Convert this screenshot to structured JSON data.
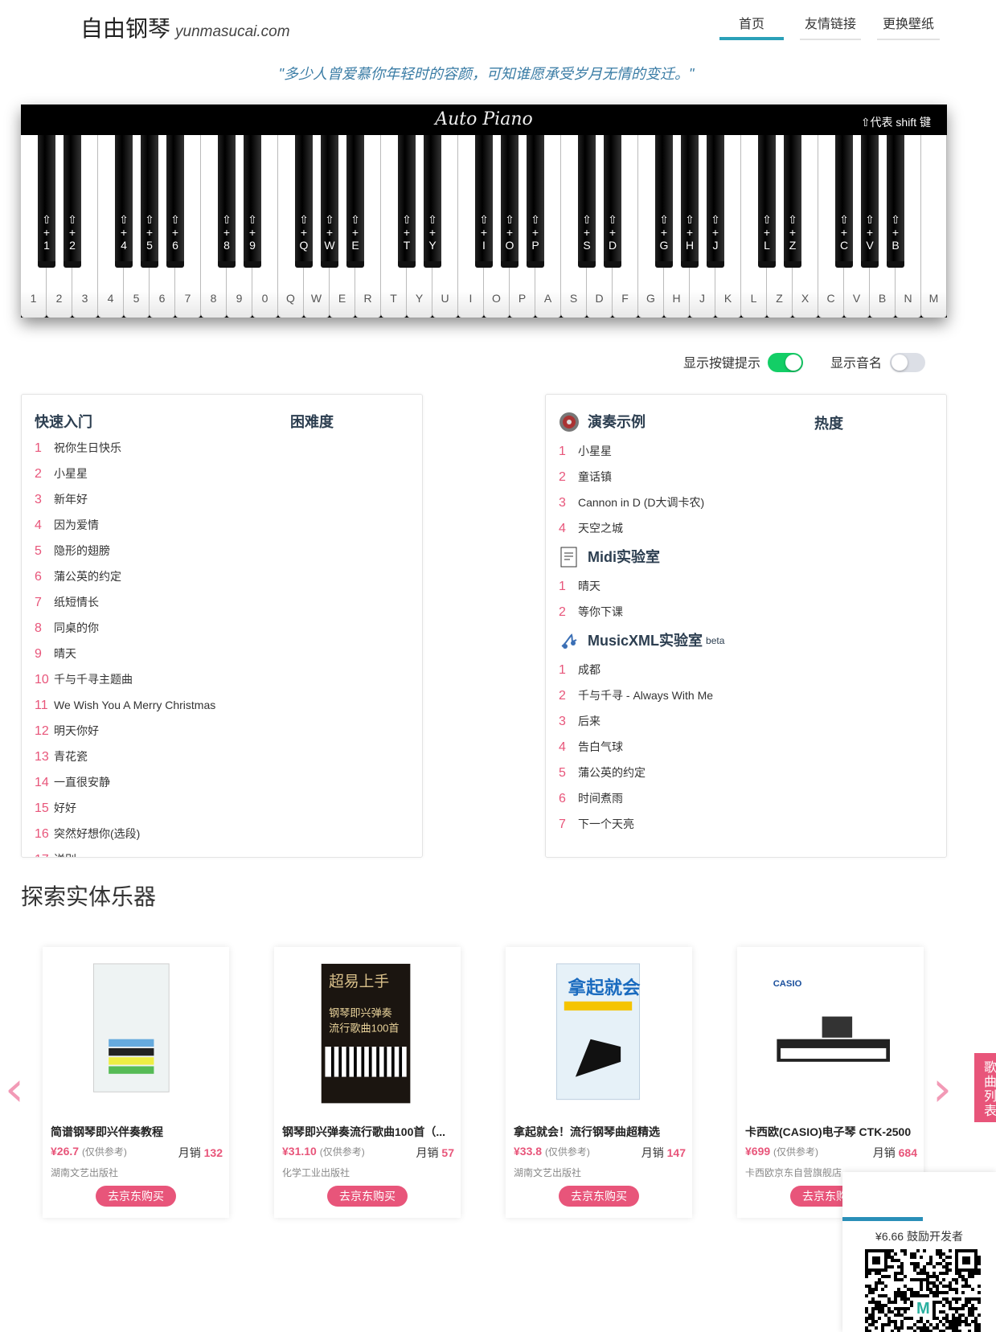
{
  "header": {
    "logo": "自由钢琴",
    "domain": "yunmasucai.com",
    "nav": [
      {
        "label": "首页",
        "active": true
      },
      {
        "label": "友情链接"
      },
      {
        "label": "更换壁纸"
      }
    ]
  },
  "quote": "\"多少人曾爱慕你年轻时的容颜，可知谁愿承受岁月无情的变迁。\"",
  "piano": {
    "title": "Auto Piano",
    "shift_note": "⇧代表 shift 键",
    "white_keys": [
      "1",
      "2",
      "3",
      "4",
      "5",
      "6",
      "7",
      "8",
      "9",
      "0",
      "Q",
      "W",
      "E",
      "R",
      "T",
      "Y",
      "U",
      "I",
      "O",
      "P",
      "A",
      "S",
      "D",
      "F",
      "G",
      "H",
      "J",
      "K",
      "L",
      "Z",
      "X",
      "C",
      "V",
      "B",
      "N",
      "M"
    ],
    "black_keys": [
      "1",
      "2",
      "4",
      "5",
      "6",
      "8",
      "9",
      "Q",
      "W",
      "E",
      "T",
      "Y",
      "I",
      "O",
      "P",
      "S",
      "D",
      "G",
      "H",
      "J",
      "L",
      "Z",
      "C",
      "V",
      "B"
    ]
  },
  "toggles": {
    "hints": {
      "label": "显示按键提示",
      "on": true,
      "color": "#13ce66"
    },
    "names": {
      "label": "显示音名",
      "on": false
    }
  },
  "left_panel": {
    "title": "快速入门",
    "col": "困难度",
    "items": [
      "祝你生日快乐",
      "小星星",
      "新年好",
      "因为爱情",
      "隐形的翅膀",
      "蒲公英的约定",
      "纸短情长",
      "同桌的你",
      "晴天",
      "千与千寻主题曲",
      "We Wish You A Merry Christmas",
      "明天你好",
      "青花瓷",
      "一直很安静",
      "好好",
      "突然好想你(选段)",
      "送别"
    ]
  },
  "right_panel": {
    "col": "热度",
    "sections": [
      {
        "title": "演奏示例",
        "icon": "record-icon",
        "items": [
          "小星星",
          "童话镇",
          "Cannon in D (D大调卡农)",
          "天空之城"
        ]
      },
      {
        "title": "Midi实验室",
        "icon": "midi-file-icon",
        "items": [
          "晴天",
          "等你下课"
        ]
      },
      {
        "title": "MusicXML实验室",
        "badge": "beta",
        "icon": "music-note-icon",
        "items": [
          "成都",
          "千与千寻 - Always With Me",
          "后来",
          "告白气球",
          "蒲公英的约定",
          "时间煮雨",
          "下一个天亮"
        ]
      }
    ]
  },
  "explore": {
    "title": "探索实体乐器",
    "products": [
      {
        "title": "简谱钢琴即兴伴奏教程",
        "price": "¥26.7",
        "ref": "(仅供参考)",
        "sales_label": "月销",
        "sales": "132",
        "publisher": "湖南文艺出版社",
        "button": "去京东购买"
      },
      {
        "title": "钢琴即兴弹奏流行歌曲100首（...",
        "price": "¥31.10",
        "ref": "(仅供参考)",
        "sales_label": "月销",
        "sales": "57",
        "publisher": "化学工业出版社",
        "button": "去京东购买"
      },
      {
        "title": "拿起就会！流行钢琴曲超精选",
        "price": "¥33.8",
        "ref": "(仅供参考)",
        "sales_label": "月销",
        "sales": "147",
        "publisher": "湖南文艺出版社",
        "button": "去京东购买"
      },
      {
        "title": "卡西欧(CASIO)电子琴 CTK-2500",
        "price": "¥699",
        "ref": "(仅供参考)",
        "sales_label": "月销",
        "sales": "684",
        "publisher": "卡西欧京东自营旗舰店",
        "button": "去京东购买",
        "brand": "CASIO"
      }
    ]
  },
  "side_tab": "歌曲列表",
  "donate": {
    "text": "¥6.66 鼓励开发者"
  },
  "colors": {
    "accent": "#e8557a",
    "nav_active": "#2aa0b8",
    "quote": "#3a7ca5"
  }
}
